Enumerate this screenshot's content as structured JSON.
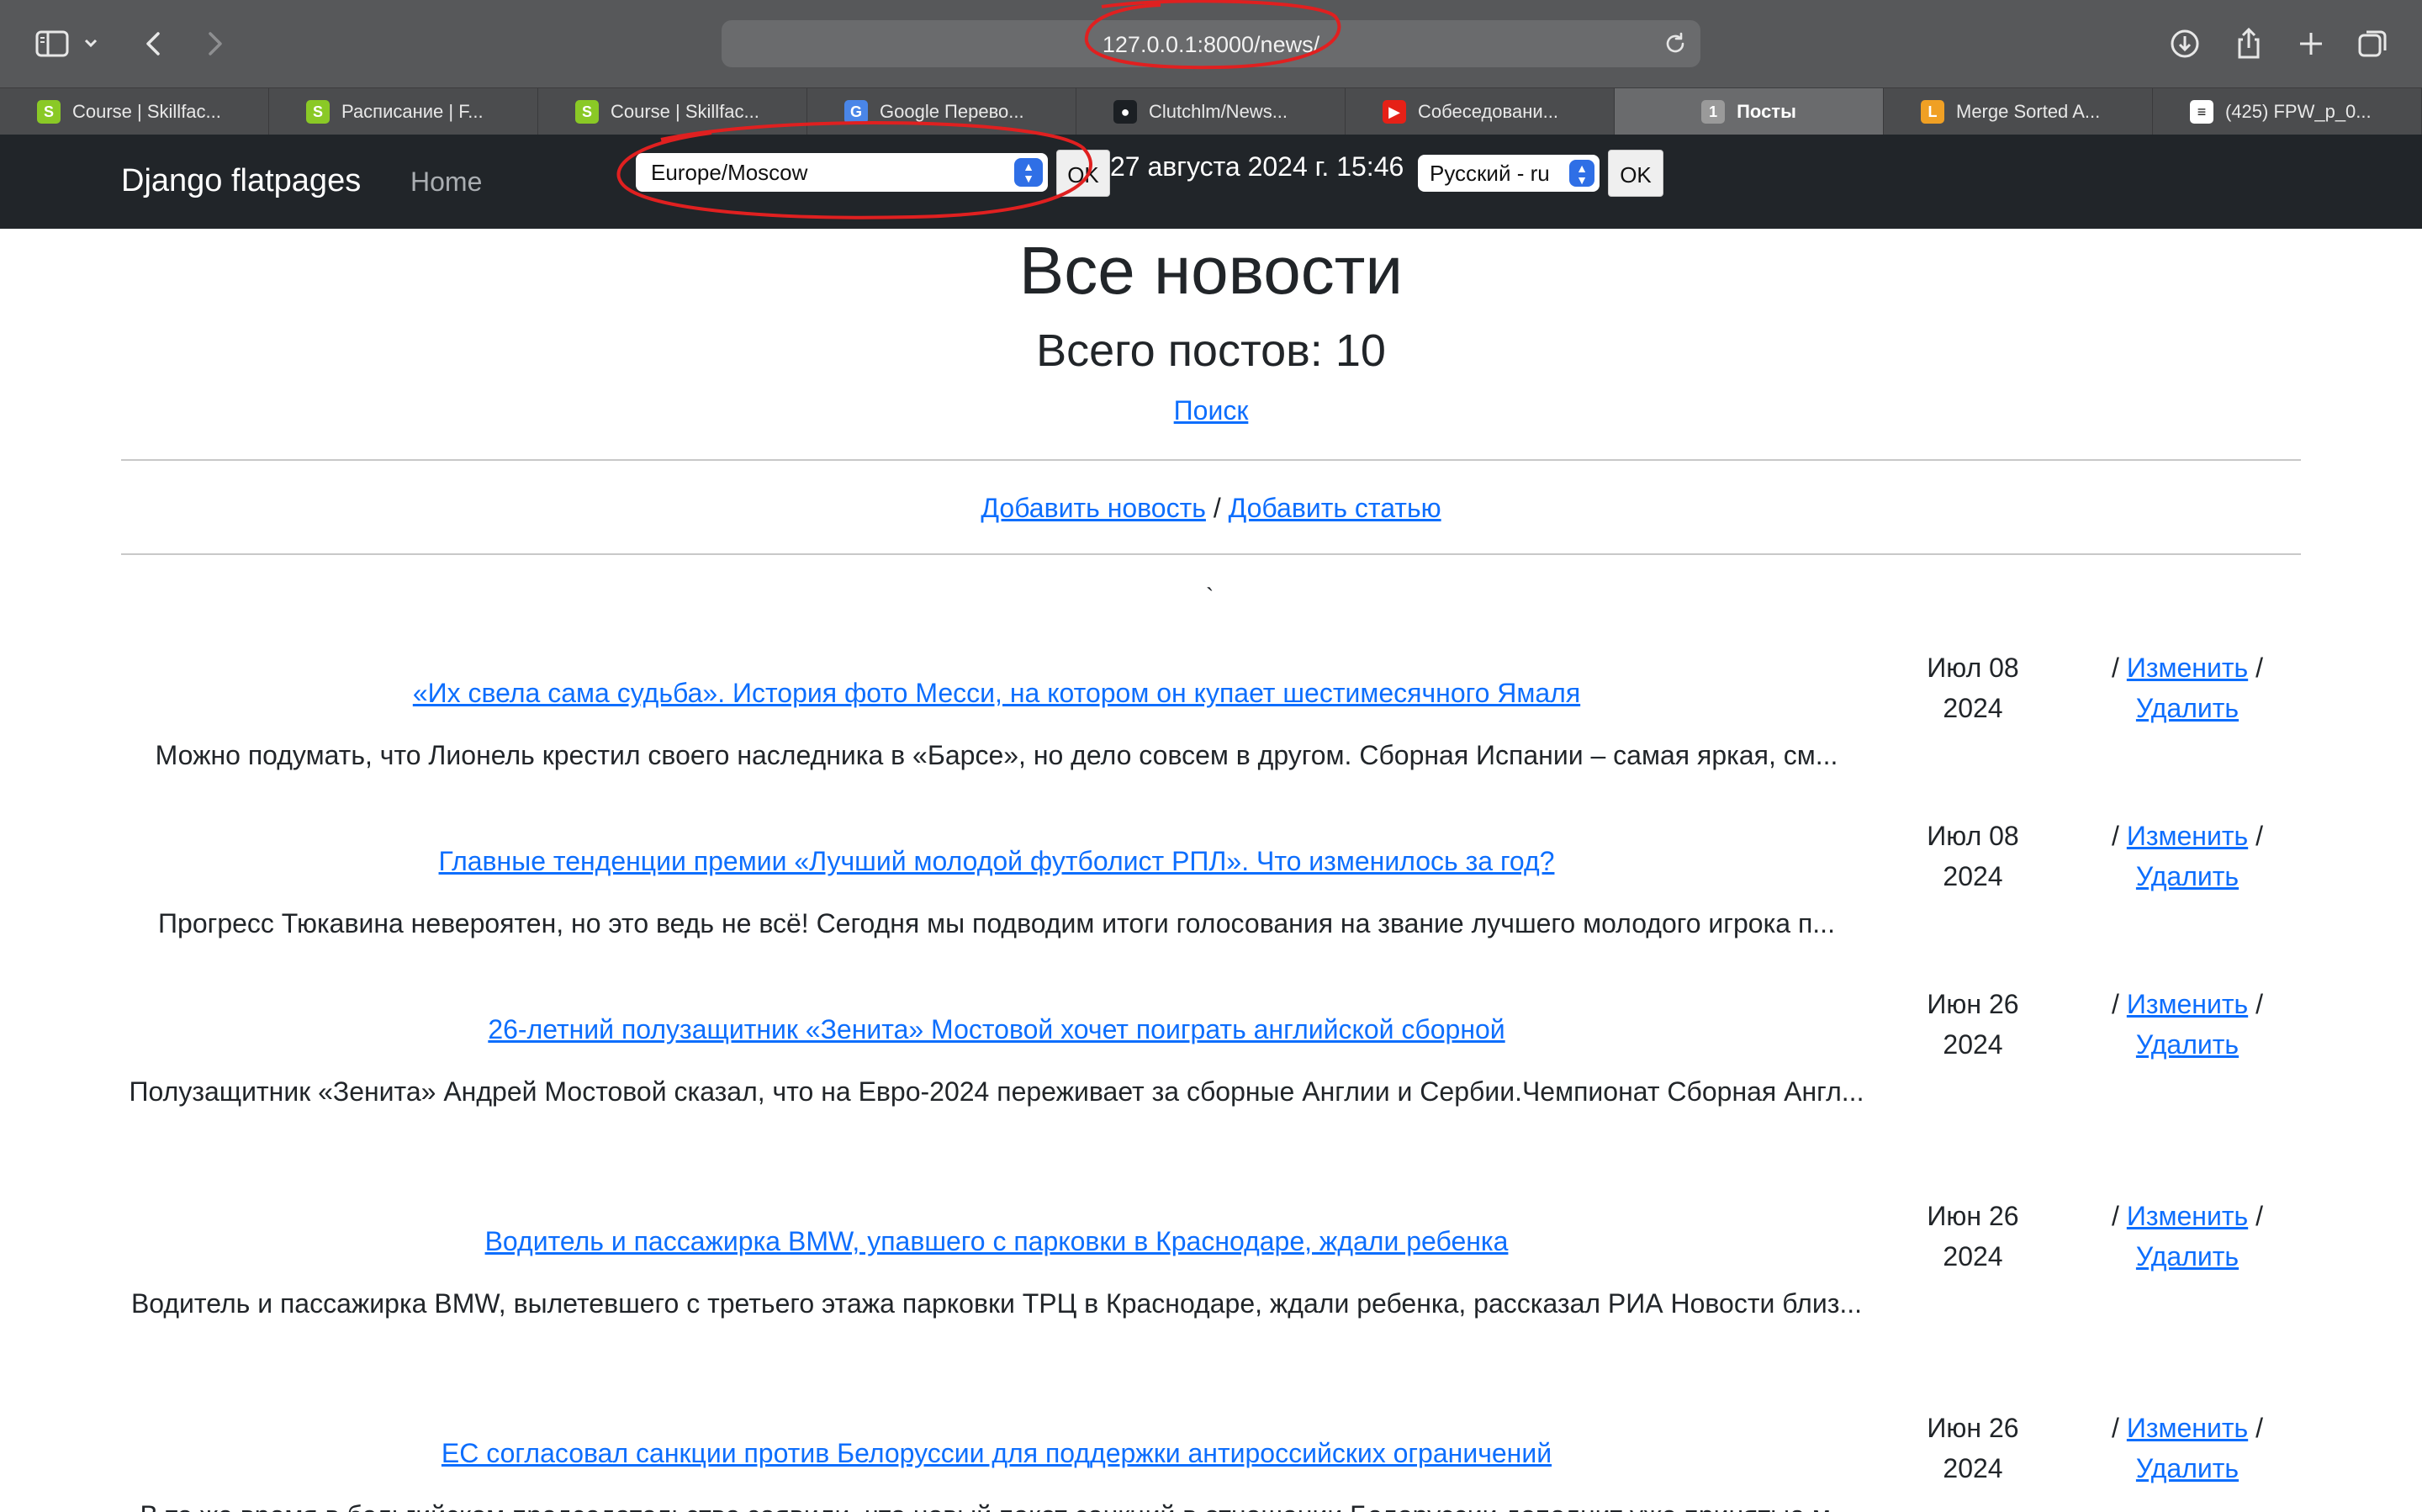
{
  "browser": {
    "url": "127.0.0.1:8000/news/",
    "tabs": [
      {
        "label": "Course | Skillfac...",
        "icon": "skillfactory-icon",
        "color": "#8ac926",
        "glyph": "S"
      },
      {
        "label": "Расписание | F...",
        "icon": "skillfactory-icon",
        "color": "#8ac926",
        "glyph": "S"
      },
      {
        "label": "Course | Skillfac...",
        "icon": "skillfactory-icon",
        "color": "#8ac926",
        "glyph": "S"
      },
      {
        "label": "Google Перево...",
        "icon": "google-translate-icon",
        "color": "#4a86e8",
        "glyph": "G"
      },
      {
        "label": "Clutchlm/News...",
        "icon": "github-icon",
        "color": "#1b1f23",
        "glyph": "●"
      },
      {
        "label": "Собеседовани...",
        "icon": "youtube-icon",
        "color": "#e62117",
        "glyph": "▶"
      },
      {
        "label": "Посты",
        "icon": "numbered-tab-icon",
        "color": "#9a9a9a",
        "glyph": "1",
        "active": true
      },
      {
        "label": "Merge Sorted A...",
        "icon": "leetcode-icon",
        "color": "#f0a024",
        "glyph": "L"
      },
      {
        "label": "(425) FPW_p_0...",
        "icon": "stack-icon",
        "color": "#ffffff",
        "glyph": "≡"
      }
    ]
  },
  "navbar": {
    "brand": "Django flatpages",
    "home": "Home",
    "timezone": "Europe/Moscow",
    "ok_label": "OK",
    "datetime": "27 августа 2024 г. 15:46",
    "language": "Русский - ru",
    "ok2_label": "OK"
  },
  "page": {
    "title": "Все новости",
    "count": "Всего постов: 10",
    "search": "Поиск",
    "add_news": "Добавить новость",
    "separator": "/",
    "add_article": "Добавить статью",
    "tick": "`"
  },
  "posts": [
    {
      "title": "«Их свела сама судьба». История фото Месси, на котором он купает шестимесячного Ямаля",
      "text": "Можно подумать, что Лионель крестил своего наследника в «Барсе», но дело совсем в другом. Сборная Испании – самая яркая, см...",
      "date_line1": "Июл 08",
      "date_line2": "2024",
      "edit": "Изменить",
      "delete": "Удалить"
    },
    {
      "title": "Главные тенденции премии «Лучший молодой футболист РПЛ». Что изменилось за год?",
      "text": "Прогресс Тюкавина невероятен, но это ведь не всё! Сегодня мы подводим итоги голосования на звание лучшего молодого игрока п...",
      "date_line1": "Июл 08",
      "date_line2": "2024",
      "edit": "Изменить",
      "delete": "Удалить"
    },
    {
      "title": "26-летний полузащитник «Зенита» Мостовой хочет поиграть английской сборной",
      "text": "Полузащитник «Зенита» Андрей Мостовой сказал, что на Евро-2024 переживает за сборные Англии и Сербии.Чемпионат Сборная Англ...",
      "date_line1": "Июн 26",
      "date_line2": "2024",
      "edit": "Изменить",
      "delete": "Удалить"
    },
    {
      "title": "Водитель и пассажирка BMW, упавшего с парковки в Краснодаре, ждали ребенка",
      "text": "Водитель и пассажирка BMW, вылетевшего с третьего этажа парковки ТРЦ в Краснодаре, ждали ребенка, рассказал РИА Новости близ...",
      "date_line1": "Июн 26",
      "date_line2": "2024",
      "edit": "Изменить",
      "delete": "Удалить"
    },
    {
      "title": "ЕС согласовал санкции против Белоруссии для поддержки антироссийских ограничений",
      "text": "В то же время в бельгийском председательстве заявили, что новый пакет санкций в отношении Белоруссии дополнит уже принятые м...",
      "date_line1": "Июн 26",
      "date_line2": "2024",
      "edit": "Изменить",
      "delete": "Удалить"
    }
  ]
}
